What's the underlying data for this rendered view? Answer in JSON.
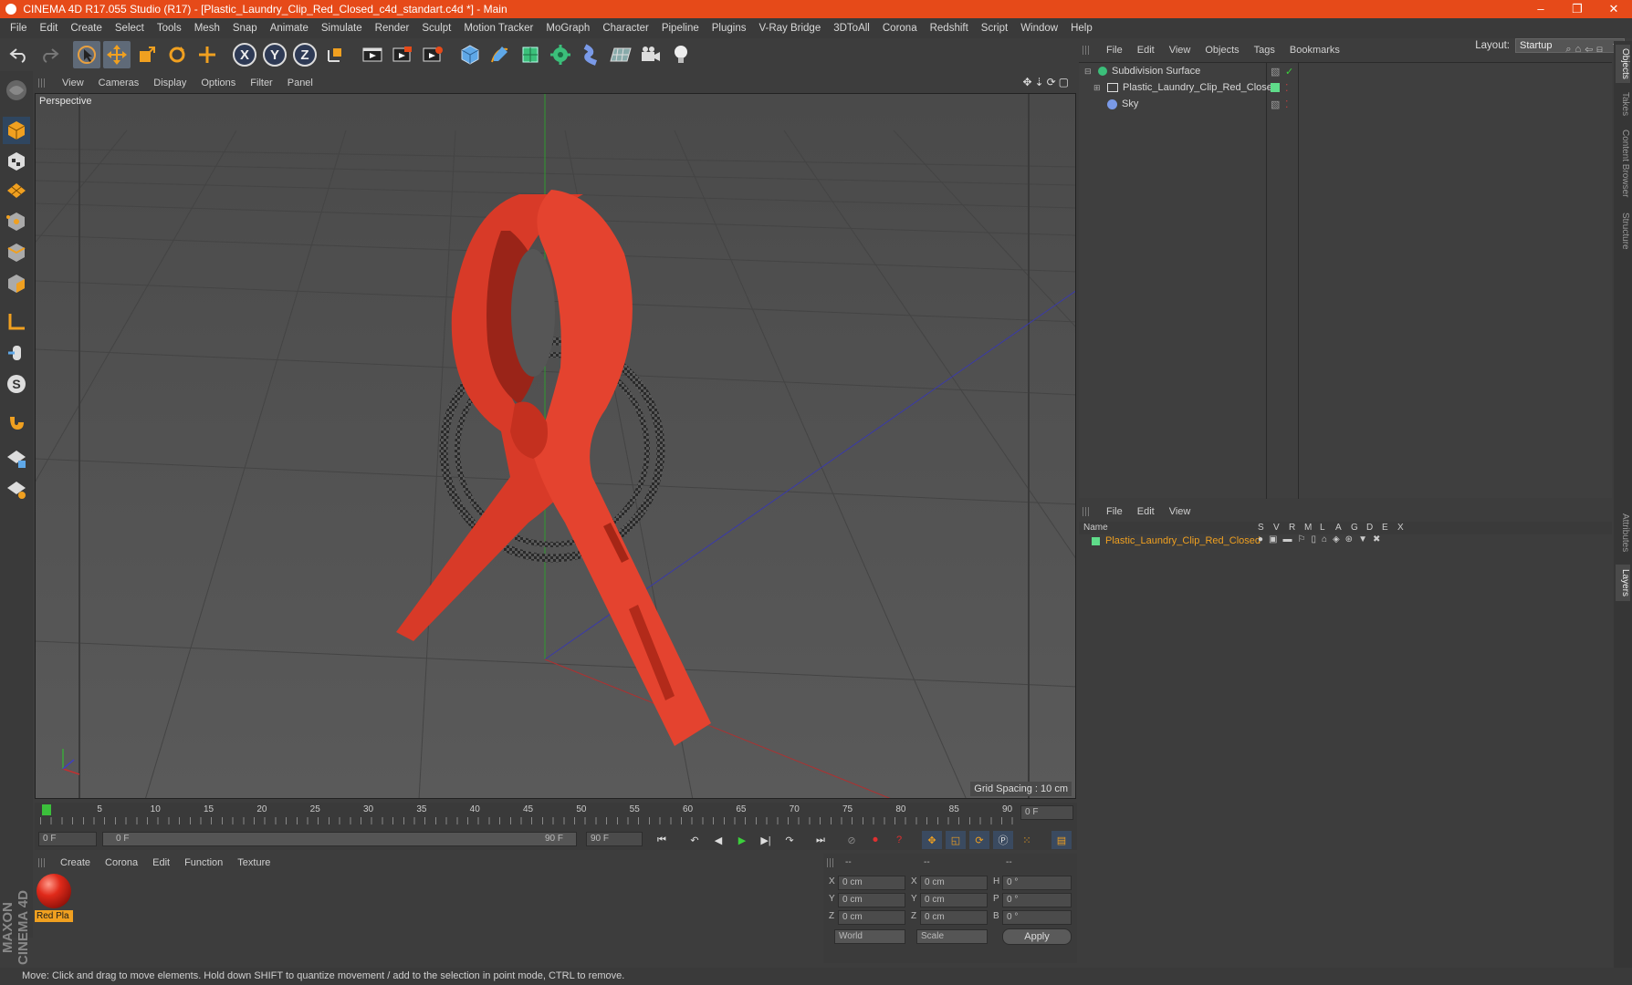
{
  "window": {
    "title": "CINEMA 4D R17.055 Studio (R17) - [Plastic_Laundry_Clip_Red_Closed_c4d_standart.c4d *] - Main"
  },
  "menubar": {
    "items": [
      "File",
      "Edit",
      "Create",
      "Select",
      "Tools",
      "Mesh",
      "Snap",
      "Animate",
      "Simulate",
      "Render",
      "Sculpt",
      "Motion Tracker",
      "MoGraph",
      "Character",
      "Pipeline",
      "Plugins",
      "V-Ray Bridge",
      "3DToAll",
      "Corona",
      "Redshift",
      "Script",
      "Window",
      "Help"
    ]
  },
  "layout": {
    "label": "Layout:",
    "value": "Startup"
  },
  "toolbar": {
    "axes": [
      "X",
      "Y",
      "Z"
    ]
  },
  "viewport": {
    "menu": [
      "View",
      "Cameras",
      "Display",
      "Options",
      "Filter",
      "Panel"
    ],
    "label": "Perspective",
    "grid_spacing": "Grid Spacing : 10 cm"
  },
  "timeline": {
    "ticks": [
      "0",
      "5",
      "10",
      "15",
      "20",
      "25",
      "30",
      "35",
      "40",
      "45",
      "50",
      "55",
      "60",
      "65",
      "70",
      "75",
      "80",
      "85",
      "90"
    ],
    "current_frame": "0 F",
    "start_field": "0 F",
    "range_start": "0 F",
    "range_end": "90 F",
    "end_field": "90 F"
  },
  "material_manager": {
    "menu": [
      "Create",
      "Corona",
      "Edit",
      "Function",
      "Texture"
    ],
    "materials": [
      {
        "name": "Red Pla"
      }
    ]
  },
  "coordinates": {
    "headers": [
      "--",
      "--",
      "--"
    ],
    "rows": [
      {
        "a": "X",
        "av": "0 cm",
        "b": "X",
        "bv": "0 cm",
        "c": "H",
        "cv": "0 °"
      },
      {
        "a": "Y",
        "av": "0 cm",
        "b": "Y",
        "bv": "0 cm",
        "c": "P",
        "cv": "0 °"
      },
      {
        "a": "Z",
        "av": "0 cm",
        "b": "Z",
        "bv": "0 cm",
        "c": "B",
        "cv": "0 °"
      }
    ],
    "mode1": "World",
    "mode2": "Scale",
    "apply": "Apply"
  },
  "object_manager": {
    "menu": [
      "File",
      "Edit",
      "View",
      "Objects",
      "Tags",
      "Bookmarks"
    ],
    "objects": [
      {
        "name": "Subdivision Surface"
      },
      {
        "name": "Plastic_Laundry_Clip_Red_Closed"
      },
      {
        "name": "Sky"
      }
    ]
  },
  "layer_manager": {
    "menu": [
      "File",
      "Edit",
      "View"
    ],
    "columns": [
      "Name",
      "S",
      "V",
      "R",
      "M",
      "L",
      "A",
      "G",
      "D",
      "E",
      "X"
    ],
    "layers": [
      {
        "name": "Plastic_Laundry_Clip_Red_Closed"
      }
    ]
  },
  "side_tabs": [
    "Objects",
    "Takes",
    "Content Browser",
    "Structure",
    "Attributes",
    "Layers"
  ],
  "brand": "MAXON CINEMA 4D",
  "status": "Move: Click and drag to move elements. Hold down SHIFT to quantize movement / add to the selection in point mode, CTRL to remove.",
  "colors": {
    "accent": "#e64a19",
    "object_red": "#e03a2a",
    "layer_highlight": "#f0a020"
  }
}
